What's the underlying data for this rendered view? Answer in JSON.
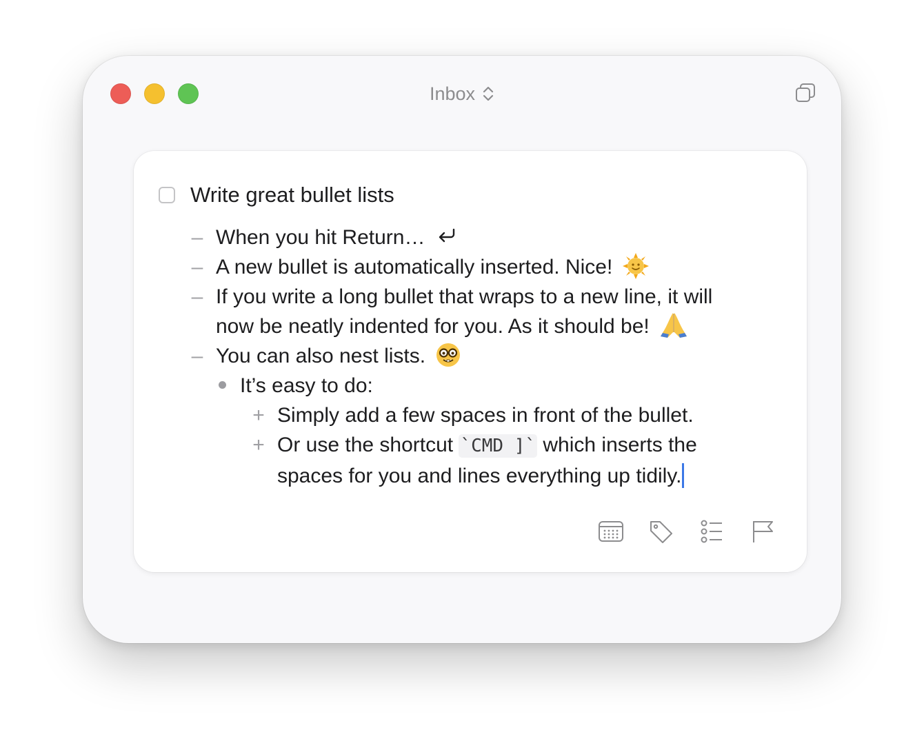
{
  "window": {
    "title": "Inbox",
    "traffic_lights": {
      "close": "#ed5d57",
      "minimize": "#f5c02f",
      "zoom": "#5fc454"
    }
  },
  "task": {
    "title": "Write great bullet lists",
    "checked": false
  },
  "notes": {
    "line1": "When you hit Return…",
    "line2": "A new bullet is automatically inserted. Nice!",
    "line3a": "If you write a long bullet that wraps to a new line, it will",
    "line3b": "now be neatly indented for you. As it should be!",
    "line4": "You can also nest lists.",
    "line5": "It’s easy to do:",
    "line6": "Simply add a few spaces in front of the bullet.",
    "line7_pre": "Or use the shortcut ",
    "line7_code": "`CMD ]`",
    "line7_post": " which inserts the",
    "line8": "spaces for you and lines everything up tidily."
  },
  "markers": {
    "dash": "–",
    "plus": "+"
  },
  "icons": {
    "title_chevron": "chevron-up-down-icon",
    "duplicate": "duplicate-window-icon",
    "return": "return-arrow-icon",
    "sun": "sun-with-face-emoji",
    "pray": "folded-hands-emoji",
    "nerd": "nerd-face-emoji",
    "calendar": "calendar-icon",
    "tag": "tag-icon",
    "checklist": "checklist-icon",
    "flag": "flag-icon"
  },
  "colors": {
    "accent_cursor": "#3b78e7",
    "text": "#1d1d1f",
    "muted": "#a0a0a4"
  }
}
